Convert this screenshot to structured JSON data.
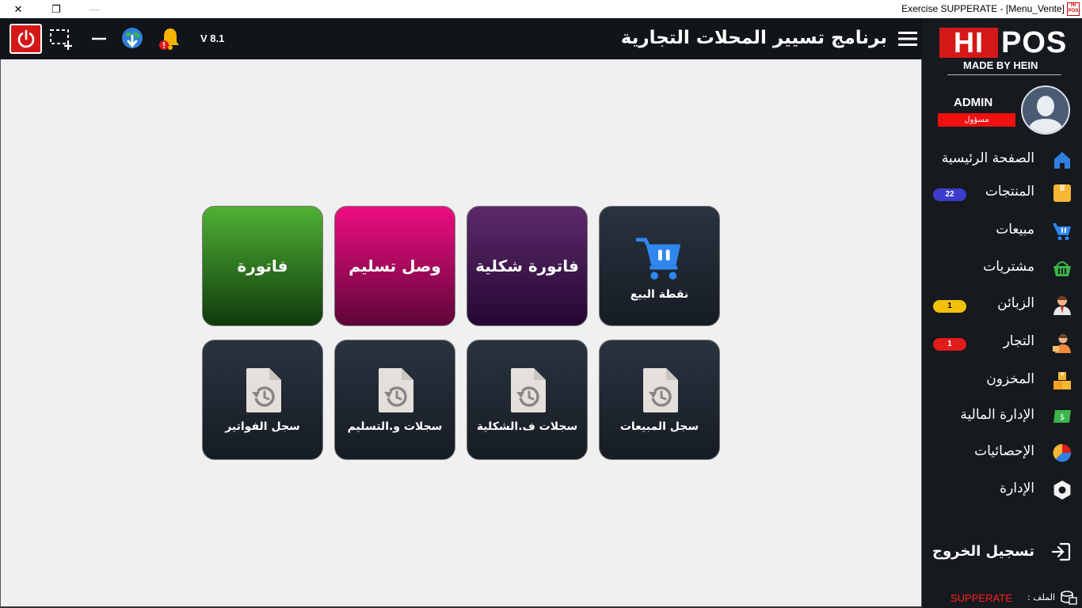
{
  "window": {
    "title": "Exercise SUPPERATE - [Menu_Vente]",
    "logo_text_top": "HI",
    "logo_text_bottom": "POS"
  },
  "header": {
    "version": "V 8.1",
    "app_title": "برنامج تسيير المحلات التجارية"
  },
  "brand": {
    "hi": "HI",
    "pos": "POS",
    "made_by": "MADE BY HEIN",
    "accent": "#d41818"
  },
  "user": {
    "name": "ADMIN",
    "role": "مسؤول"
  },
  "sidebar": {
    "items": [
      {
        "label": "الصفحة الرئيسية",
        "icon": "home-icon",
        "badge": null
      },
      {
        "label": "المنتجات",
        "icon": "product-box-icon",
        "badge": "22",
        "badge_color": "#3c3ccc"
      },
      {
        "label": "مبيعات",
        "icon": "cart-icon",
        "badge": null
      },
      {
        "label": "مشتريات",
        "icon": "basket-icon",
        "badge": null
      },
      {
        "label": "الزبائن",
        "icon": "customer-icon",
        "badge": "1",
        "badge_color": "#f2c10a"
      },
      {
        "label": "التجار",
        "icon": "merchant-icon",
        "badge": "1",
        "badge_color": "#e21b1b"
      },
      {
        "label": "المخزون",
        "icon": "warehouse-boxes-icon",
        "badge": null
      },
      {
        "label": "الإدارة المالية",
        "icon": "money-icon",
        "badge": null
      },
      {
        "label": "الإحصائيات",
        "icon": "pie-chart-icon",
        "badge": null
      },
      {
        "label": "الإدارة",
        "icon": "settings-hex-icon",
        "badge": null
      }
    ],
    "logout": "تسجيل الخروج",
    "file_label": "الملف :",
    "file_value": "SUPPERATE"
  },
  "tiles": {
    "row1": [
      {
        "label": "نقطة البيع",
        "style": "dark",
        "icon": "shopping-cart-icon"
      },
      {
        "label": "فاتورة شكلية",
        "style": "purple"
      },
      {
        "label": "وصل تسليم",
        "style": "pink"
      },
      {
        "label": "فاتورة",
        "style": "green"
      }
    ],
    "row2": [
      {
        "label": "سجل المبيعات",
        "icon": "history-document-icon"
      },
      {
        "label": "سجلات ف.الشكلية",
        "icon": "history-document-icon"
      },
      {
        "label": "سجلات و.التسليم",
        "icon": "history-document-icon"
      },
      {
        "label": "سجل الفواتير",
        "icon": "history-document-icon"
      }
    ]
  }
}
